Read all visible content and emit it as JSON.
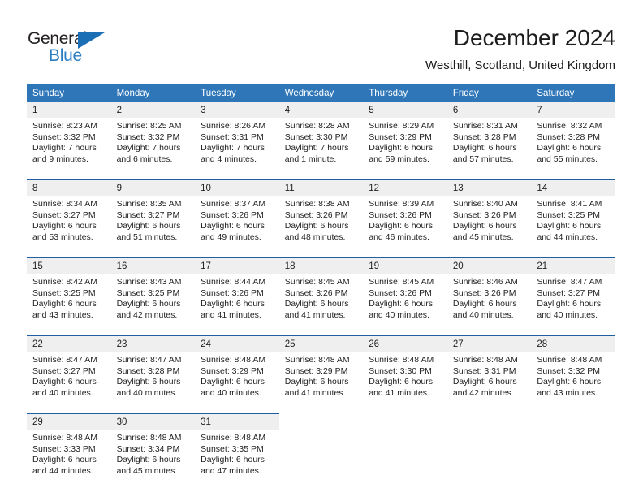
{
  "brand": {
    "name_part1": "General",
    "name_part2": "Blue",
    "triangle_icon": "triangle-icon",
    "color_dark": "#231f20",
    "color_blue": "#2a7fc4"
  },
  "header": {
    "title": "December 2024",
    "subtitle": "Westhill, Scotland, United Kingdom"
  },
  "theme": {
    "header_blue": "#2e76b8",
    "row_divider_blue": "#1f5fa0",
    "daynum_band": "#efefef"
  },
  "weekdays": [
    "Sunday",
    "Monday",
    "Tuesday",
    "Wednesday",
    "Thursday",
    "Friday",
    "Saturday"
  ],
  "weeks": [
    [
      {
        "day": "1",
        "sunrise": "Sunrise: 8:23 AM",
        "sunset": "Sunset: 3:32 PM",
        "daylight1": "Daylight: 7 hours",
        "daylight2": "and 9 minutes."
      },
      {
        "day": "2",
        "sunrise": "Sunrise: 8:25 AM",
        "sunset": "Sunset: 3:32 PM",
        "daylight1": "Daylight: 7 hours",
        "daylight2": "and 6 minutes."
      },
      {
        "day": "3",
        "sunrise": "Sunrise: 8:26 AM",
        "sunset": "Sunset: 3:31 PM",
        "daylight1": "Daylight: 7 hours",
        "daylight2": "and 4 minutes."
      },
      {
        "day": "4",
        "sunrise": "Sunrise: 8:28 AM",
        "sunset": "Sunset: 3:30 PM",
        "daylight1": "Daylight: 7 hours",
        "daylight2": "and 1 minute."
      },
      {
        "day": "5",
        "sunrise": "Sunrise: 8:29 AM",
        "sunset": "Sunset: 3:29 PM",
        "daylight1": "Daylight: 6 hours",
        "daylight2": "and 59 minutes."
      },
      {
        "day": "6",
        "sunrise": "Sunrise: 8:31 AM",
        "sunset": "Sunset: 3:28 PM",
        "daylight1": "Daylight: 6 hours",
        "daylight2": "and 57 minutes."
      },
      {
        "day": "7",
        "sunrise": "Sunrise: 8:32 AM",
        "sunset": "Sunset: 3:28 PM",
        "daylight1": "Daylight: 6 hours",
        "daylight2": "and 55 minutes."
      }
    ],
    [
      {
        "day": "8",
        "sunrise": "Sunrise: 8:34 AM",
        "sunset": "Sunset: 3:27 PM",
        "daylight1": "Daylight: 6 hours",
        "daylight2": "and 53 minutes."
      },
      {
        "day": "9",
        "sunrise": "Sunrise: 8:35 AM",
        "sunset": "Sunset: 3:27 PM",
        "daylight1": "Daylight: 6 hours",
        "daylight2": "and 51 minutes."
      },
      {
        "day": "10",
        "sunrise": "Sunrise: 8:37 AM",
        "sunset": "Sunset: 3:26 PM",
        "daylight1": "Daylight: 6 hours",
        "daylight2": "and 49 minutes."
      },
      {
        "day": "11",
        "sunrise": "Sunrise: 8:38 AM",
        "sunset": "Sunset: 3:26 PM",
        "daylight1": "Daylight: 6 hours",
        "daylight2": "and 48 minutes."
      },
      {
        "day": "12",
        "sunrise": "Sunrise: 8:39 AM",
        "sunset": "Sunset: 3:26 PM",
        "daylight1": "Daylight: 6 hours",
        "daylight2": "and 46 minutes."
      },
      {
        "day": "13",
        "sunrise": "Sunrise: 8:40 AM",
        "sunset": "Sunset: 3:26 PM",
        "daylight1": "Daylight: 6 hours",
        "daylight2": "and 45 minutes."
      },
      {
        "day": "14",
        "sunrise": "Sunrise: 8:41 AM",
        "sunset": "Sunset: 3:25 PM",
        "daylight1": "Daylight: 6 hours",
        "daylight2": "and 44 minutes."
      }
    ],
    [
      {
        "day": "15",
        "sunrise": "Sunrise: 8:42 AM",
        "sunset": "Sunset: 3:25 PM",
        "daylight1": "Daylight: 6 hours",
        "daylight2": "and 43 minutes."
      },
      {
        "day": "16",
        "sunrise": "Sunrise: 8:43 AM",
        "sunset": "Sunset: 3:25 PM",
        "daylight1": "Daylight: 6 hours",
        "daylight2": "and 42 minutes."
      },
      {
        "day": "17",
        "sunrise": "Sunrise: 8:44 AM",
        "sunset": "Sunset: 3:26 PM",
        "daylight1": "Daylight: 6 hours",
        "daylight2": "and 41 minutes."
      },
      {
        "day": "18",
        "sunrise": "Sunrise: 8:45 AM",
        "sunset": "Sunset: 3:26 PM",
        "daylight1": "Daylight: 6 hours",
        "daylight2": "and 41 minutes."
      },
      {
        "day": "19",
        "sunrise": "Sunrise: 8:45 AM",
        "sunset": "Sunset: 3:26 PM",
        "daylight1": "Daylight: 6 hours",
        "daylight2": "and 40 minutes."
      },
      {
        "day": "20",
        "sunrise": "Sunrise: 8:46 AM",
        "sunset": "Sunset: 3:26 PM",
        "daylight1": "Daylight: 6 hours",
        "daylight2": "and 40 minutes."
      },
      {
        "day": "21",
        "sunrise": "Sunrise: 8:47 AM",
        "sunset": "Sunset: 3:27 PM",
        "daylight1": "Daylight: 6 hours",
        "daylight2": "and 40 minutes."
      }
    ],
    [
      {
        "day": "22",
        "sunrise": "Sunrise: 8:47 AM",
        "sunset": "Sunset: 3:27 PM",
        "daylight1": "Daylight: 6 hours",
        "daylight2": "and 40 minutes."
      },
      {
        "day": "23",
        "sunrise": "Sunrise: 8:47 AM",
        "sunset": "Sunset: 3:28 PM",
        "daylight1": "Daylight: 6 hours",
        "daylight2": "and 40 minutes."
      },
      {
        "day": "24",
        "sunrise": "Sunrise: 8:48 AM",
        "sunset": "Sunset: 3:29 PM",
        "daylight1": "Daylight: 6 hours",
        "daylight2": "and 40 minutes."
      },
      {
        "day": "25",
        "sunrise": "Sunrise: 8:48 AM",
        "sunset": "Sunset: 3:29 PM",
        "daylight1": "Daylight: 6 hours",
        "daylight2": "and 41 minutes."
      },
      {
        "day": "26",
        "sunrise": "Sunrise: 8:48 AM",
        "sunset": "Sunset: 3:30 PM",
        "daylight1": "Daylight: 6 hours",
        "daylight2": "and 41 minutes."
      },
      {
        "day": "27",
        "sunrise": "Sunrise: 8:48 AM",
        "sunset": "Sunset: 3:31 PM",
        "daylight1": "Daylight: 6 hours",
        "daylight2": "and 42 minutes."
      },
      {
        "day": "28",
        "sunrise": "Sunrise: 8:48 AM",
        "sunset": "Sunset: 3:32 PM",
        "daylight1": "Daylight: 6 hours",
        "daylight2": "and 43 minutes."
      }
    ],
    [
      {
        "day": "29",
        "sunrise": "Sunrise: 8:48 AM",
        "sunset": "Sunset: 3:33 PM",
        "daylight1": "Daylight: 6 hours",
        "daylight2": "and 44 minutes."
      },
      {
        "day": "30",
        "sunrise": "Sunrise: 8:48 AM",
        "sunset": "Sunset: 3:34 PM",
        "daylight1": "Daylight: 6 hours",
        "daylight2": "and 45 minutes."
      },
      {
        "day": "31",
        "sunrise": "Sunrise: 8:48 AM",
        "sunset": "Sunset: 3:35 PM",
        "daylight1": "Daylight: 6 hours",
        "daylight2": "and 47 minutes."
      },
      {
        "day": "",
        "sunrise": "",
        "sunset": "",
        "daylight1": "",
        "daylight2": ""
      },
      {
        "day": "",
        "sunrise": "",
        "sunset": "",
        "daylight1": "",
        "daylight2": ""
      },
      {
        "day": "",
        "sunrise": "",
        "sunset": "",
        "daylight1": "",
        "daylight2": ""
      },
      {
        "day": "",
        "sunrise": "",
        "sunset": "",
        "daylight1": "",
        "daylight2": ""
      }
    ]
  ]
}
